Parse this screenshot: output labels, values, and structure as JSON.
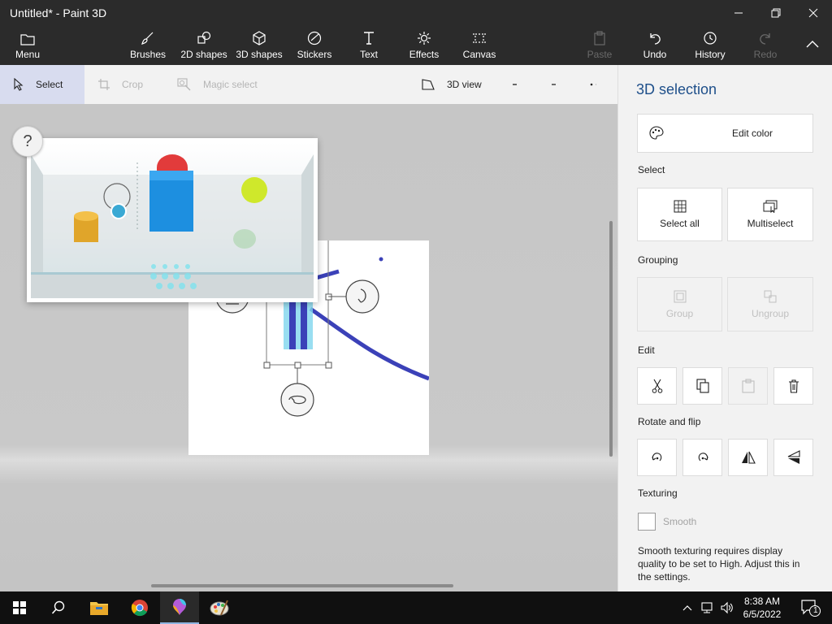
{
  "window": {
    "title": "Untitled* - Paint 3D"
  },
  "ribbon": {
    "menu": "Menu",
    "brushes": "Brushes",
    "shapes2d": "2D shapes",
    "shapes3d": "3D shapes",
    "stickers": "Stickers",
    "text": "Text",
    "effects": "Effects",
    "canvas": "Canvas",
    "paste": "Paste",
    "undo": "Undo",
    "history": "History",
    "redo": "Redo"
  },
  "toolbar": {
    "select": "Select",
    "crop": "Crop",
    "magic_select": "Magic select",
    "view3d": "3D view"
  },
  "help": {
    "button": "?"
  },
  "panel": {
    "title": "3D selection",
    "edit_color": "Edit color",
    "select_label": "Select",
    "select_all": "Select all",
    "multiselect": "Multiselect",
    "grouping_label": "Grouping",
    "group": "Group",
    "ungroup": "Ungroup",
    "edit_label": "Edit",
    "rotate_label": "Rotate and flip",
    "texturing_label": "Texturing",
    "smooth": "Smooth",
    "note": "Smooth texturing requires display quality to be set to High. Adjust this in the settings."
  },
  "taskbar": {
    "time": "8:38 AM",
    "date": "6/5/2022",
    "notification_count": "1"
  },
  "colors": {
    "accent": "#1e4f8a",
    "ink": "#3b41b8",
    "dark": "#2b2b2b"
  }
}
